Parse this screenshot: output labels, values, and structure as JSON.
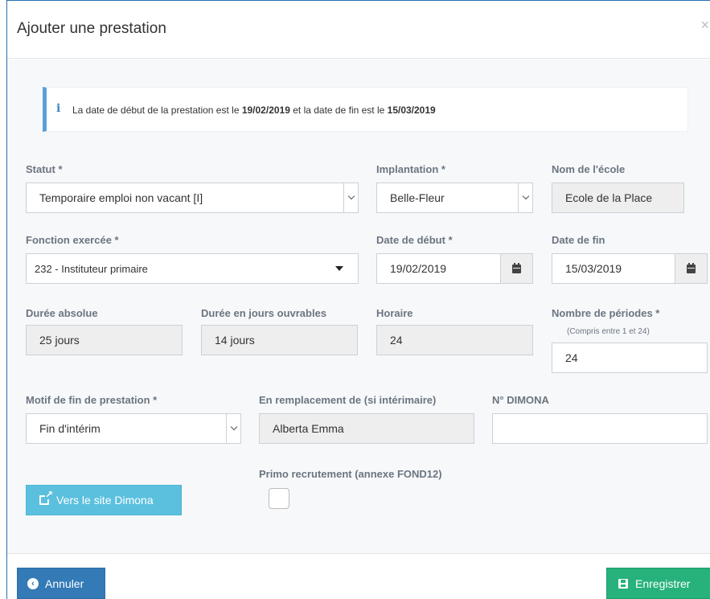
{
  "modal": {
    "title": "Ajouter une prestation",
    "close_glyph": "×"
  },
  "alert": {
    "icon": "info-icon",
    "text_before": "La date de début de la prestation est le ",
    "start_date": "19/02/2019",
    "text_middle": " et la date de fin est le ",
    "end_date": "15/03/2019"
  },
  "form": {
    "statut": {
      "label": "Statut *",
      "value": "Temporaire emploi non vacant [I]"
    },
    "implantation": {
      "label": "Implantation *",
      "value": "Belle-Fleur"
    },
    "nom_ecole": {
      "label": "Nom de l'école",
      "value": "Ecole de la Place"
    },
    "fonction": {
      "label": "Fonction exercée *",
      "value": "232 - Instituteur primaire"
    },
    "date_debut": {
      "label": "Date de début *",
      "value": "19/02/2019"
    },
    "date_fin": {
      "label": "Date de fin",
      "value": "15/03/2019"
    },
    "duree_absolue": {
      "label": "Durée absolue",
      "value": "25 jours"
    },
    "duree_ouvrables": {
      "label": "Durée en jours ouvrables",
      "value": "14 jours"
    },
    "horaire": {
      "label": "Horaire",
      "value": "24"
    },
    "nombre_periodes": {
      "label": "Nombre de périodes *",
      "hint": "(Compris entre 1 et 24)",
      "value": "24"
    },
    "motif_fin": {
      "label": "Motif de fin de prestation *",
      "value": "Fin d'intérim"
    },
    "remplacement": {
      "label": "En remplacement de (si intérimaire)",
      "value": "Alberta Emma"
    },
    "dimona": {
      "label": "N° DIMONA",
      "value": ""
    },
    "primo": {
      "label": "Primo recrutement (annexe FOND12)",
      "checked": false
    }
  },
  "buttons": {
    "dimona_site": "Vers le site Dimona",
    "cancel": "Annuler",
    "save": "Enregistrer"
  },
  "colors": {
    "primary": "#337ab7",
    "info": "#5bc0de",
    "success": "#26b27a",
    "alert_border": "#5aa0d8"
  }
}
